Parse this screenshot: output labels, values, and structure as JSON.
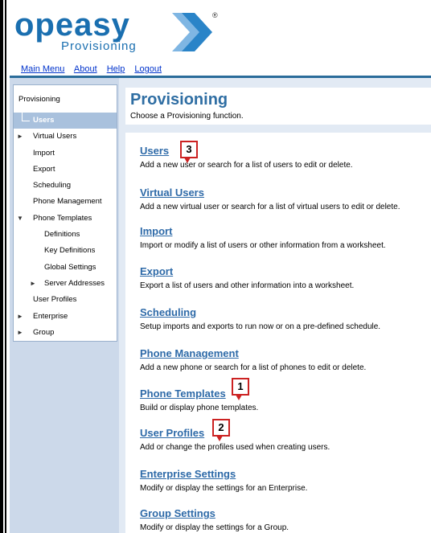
{
  "header": {
    "logo_text": "opeasy",
    "logo_subtext": "Provisioning",
    "registered_mark": "®",
    "nav": [
      "Main Menu",
      "About",
      "Help",
      "Logout"
    ]
  },
  "sidebar": {
    "heading": "Provisioning",
    "items": [
      {
        "label": "Users",
        "indent": 1,
        "arrow": "",
        "selected": true
      },
      {
        "label": "Virtual Users",
        "indent": 1,
        "arrow": "►"
      },
      {
        "label": "Import",
        "indent": 1,
        "arrow": ""
      },
      {
        "label": "Export",
        "indent": 1,
        "arrow": ""
      },
      {
        "label": "Scheduling",
        "indent": 1,
        "arrow": ""
      },
      {
        "label": "Phone Management",
        "indent": 1,
        "arrow": ""
      },
      {
        "label": "Phone Templates",
        "indent": 1,
        "arrow": "▼"
      },
      {
        "label": "Definitions",
        "indent": 2,
        "arrow": ""
      },
      {
        "label": "Key Definitions",
        "indent": 2,
        "arrow": ""
      },
      {
        "label": "Global Settings",
        "indent": 2,
        "arrow": ""
      },
      {
        "label": "Server Addresses",
        "indent": 2,
        "arrow": "►"
      },
      {
        "label": "User Profiles",
        "indent": 1,
        "arrow": ""
      },
      {
        "label": "Enterprise",
        "indent": 1,
        "arrow": "►"
      },
      {
        "label": "Group",
        "indent": 1,
        "arrow": "►"
      }
    ]
  },
  "main": {
    "title": "Provisioning",
    "subtitle": "Choose a Provisioning function.",
    "entries": [
      {
        "name": "users",
        "link": "Users",
        "desc": "Add a new user or search for a list of users to edit or delete."
      },
      {
        "name": "virtual-users",
        "link": "Virtual Users",
        "desc": "Add a new virtual user or search for a list of virtual users to edit or delete."
      },
      {
        "name": "import",
        "link": "Import",
        "desc": "Import or modify a list of users or other information from a worksheet."
      },
      {
        "name": "export",
        "link": "Export",
        "desc": "Export a list of users and other information into a worksheet."
      },
      {
        "name": "scheduling",
        "link": "Scheduling",
        "desc": "Setup imports and exports to run now or on a pre-defined schedule."
      },
      {
        "name": "phone-management",
        "link": "Phone Management",
        "desc": "Add a new phone or search for a list of phones to edit or delete."
      },
      {
        "name": "phone-templates",
        "link": "Phone Templates",
        "desc": "Build or display phone templates."
      },
      {
        "name": "user-profiles",
        "link": "User Profiles",
        "desc": "Add or change the profiles used when creating users."
      },
      {
        "name": "enterprise-settings",
        "link": "Enterprise Settings",
        "desc": "Modify or display the settings for an Enterprise."
      },
      {
        "name": "group-settings",
        "link": "Group Settings",
        "desc": "Modify or display the settings for a Group."
      }
    ]
  },
  "callouts": [
    "3",
    "1",
    "2"
  ],
  "colors": {
    "accent": "#2e6aa8",
    "sidebar_bg": "#ccd9ea",
    "callout_border": "#cc2222"
  }
}
